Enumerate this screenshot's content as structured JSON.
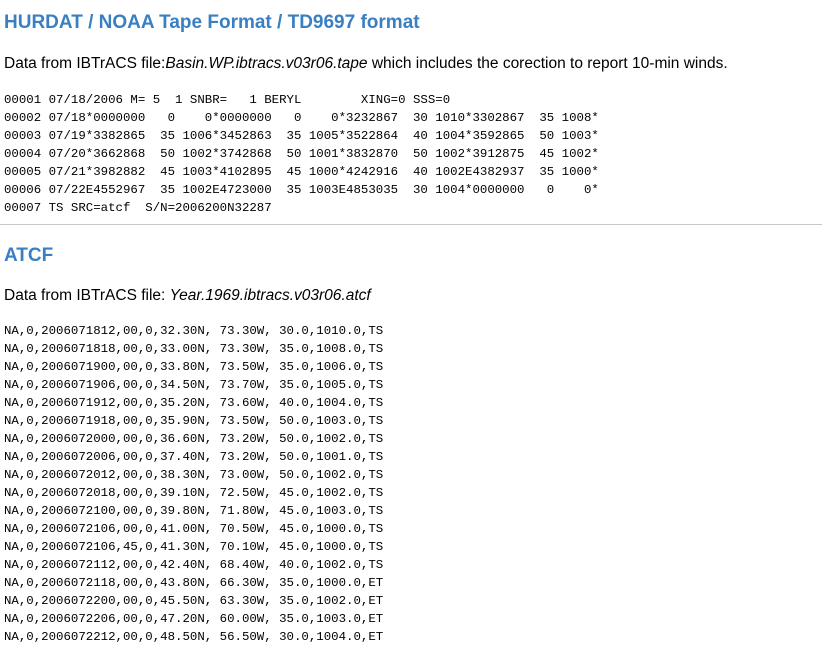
{
  "hurdat": {
    "title": "HURDAT / NOAA Tape Format / TD9697 format",
    "desc_prefix": "Data from IBTrACS file:",
    "desc_filename": "Basin.WP.ibtracs.v03r06.tape",
    "desc_suffix": " which includes the corection to report 10-min winds.",
    "lines": [
      "00001 07/18/2006 M= 5  1 SNBR=   1 BERYL        XING=0 SSS=0",
      "00002 07/18*0000000   0    0*0000000   0    0*3232867  30 1010*3302867  35 1008*",
      "00003 07/19*3382865  35 1006*3452863  35 1005*3522864  40 1004*3592865  50 1003*",
      "00004 07/20*3662868  50 1002*3742868  50 1001*3832870  50 1002*3912875  45 1002*",
      "00005 07/21*3982882  45 1003*4102895  45 1000*4242916  40 1002E4382937  35 1000*",
      "00006 07/22E4552967  35 1002E4723000  35 1003E4853035  30 1004*0000000   0    0*",
      "00007 TS SRC=atcf  S/N=2006200N32287"
    ]
  },
  "atcf": {
    "title": "ATCF",
    "desc_prefix": "Data from IBTrACS file: ",
    "desc_filename": "Year.1969.ibtracs.v03r06.atcf",
    "lines": [
      "NA,0,2006071812,00,0,32.30N, 73.30W, 30.0,1010.0,TS",
      "NA,0,2006071818,00,0,33.00N, 73.30W, 35.0,1008.0,TS",
      "NA,0,2006071900,00,0,33.80N, 73.50W, 35.0,1006.0,TS",
      "NA,0,2006071906,00,0,34.50N, 73.70W, 35.0,1005.0,TS",
      "NA,0,2006071912,00,0,35.20N, 73.60W, 40.0,1004.0,TS",
      "NA,0,2006071918,00,0,35.90N, 73.50W, 50.0,1003.0,TS",
      "NA,0,2006072000,00,0,36.60N, 73.20W, 50.0,1002.0,TS",
      "NA,0,2006072006,00,0,37.40N, 73.20W, 50.0,1001.0,TS",
      "NA,0,2006072012,00,0,38.30N, 73.00W, 50.0,1002.0,TS",
      "NA,0,2006072018,00,0,39.10N, 72.50W, 45.0,1002.0,TS",
      "NA,0,2006072100,00,0,39.80N, 71.80W, 45.0,1003.0,TS",
      "NA,0,2006072106,00,0,41.00N, 70.50W, 45.0,1000.0,TS",
      "NA,0,2006072106,45,0,41.30N, 70.10W, 45.0,1000.0,TS",
      "NA,0,2006072112,00,0,42.40N, 68.40W, 40.0,1002.0,TS",
      "NA,0,2006072118,00,0,43.80N, 66.30W, 35.0,1000.0,ET",
      "NA,0,2006072200,00,0,45.50N, 63.30W, 35.0,1002.0,ET",
      "NA,0,2006072206,00,0,47.20N, 60.00W, 35.0,1003.0,ET",
      "NA,0,2006072212,00,0,48.50N, 56.50W, 30.0,1004.0,ET"
    ]
  },
  "colors": {
    "heading": "#3a7fc1",
    "divider": "#c8c8c8"
  }
}
